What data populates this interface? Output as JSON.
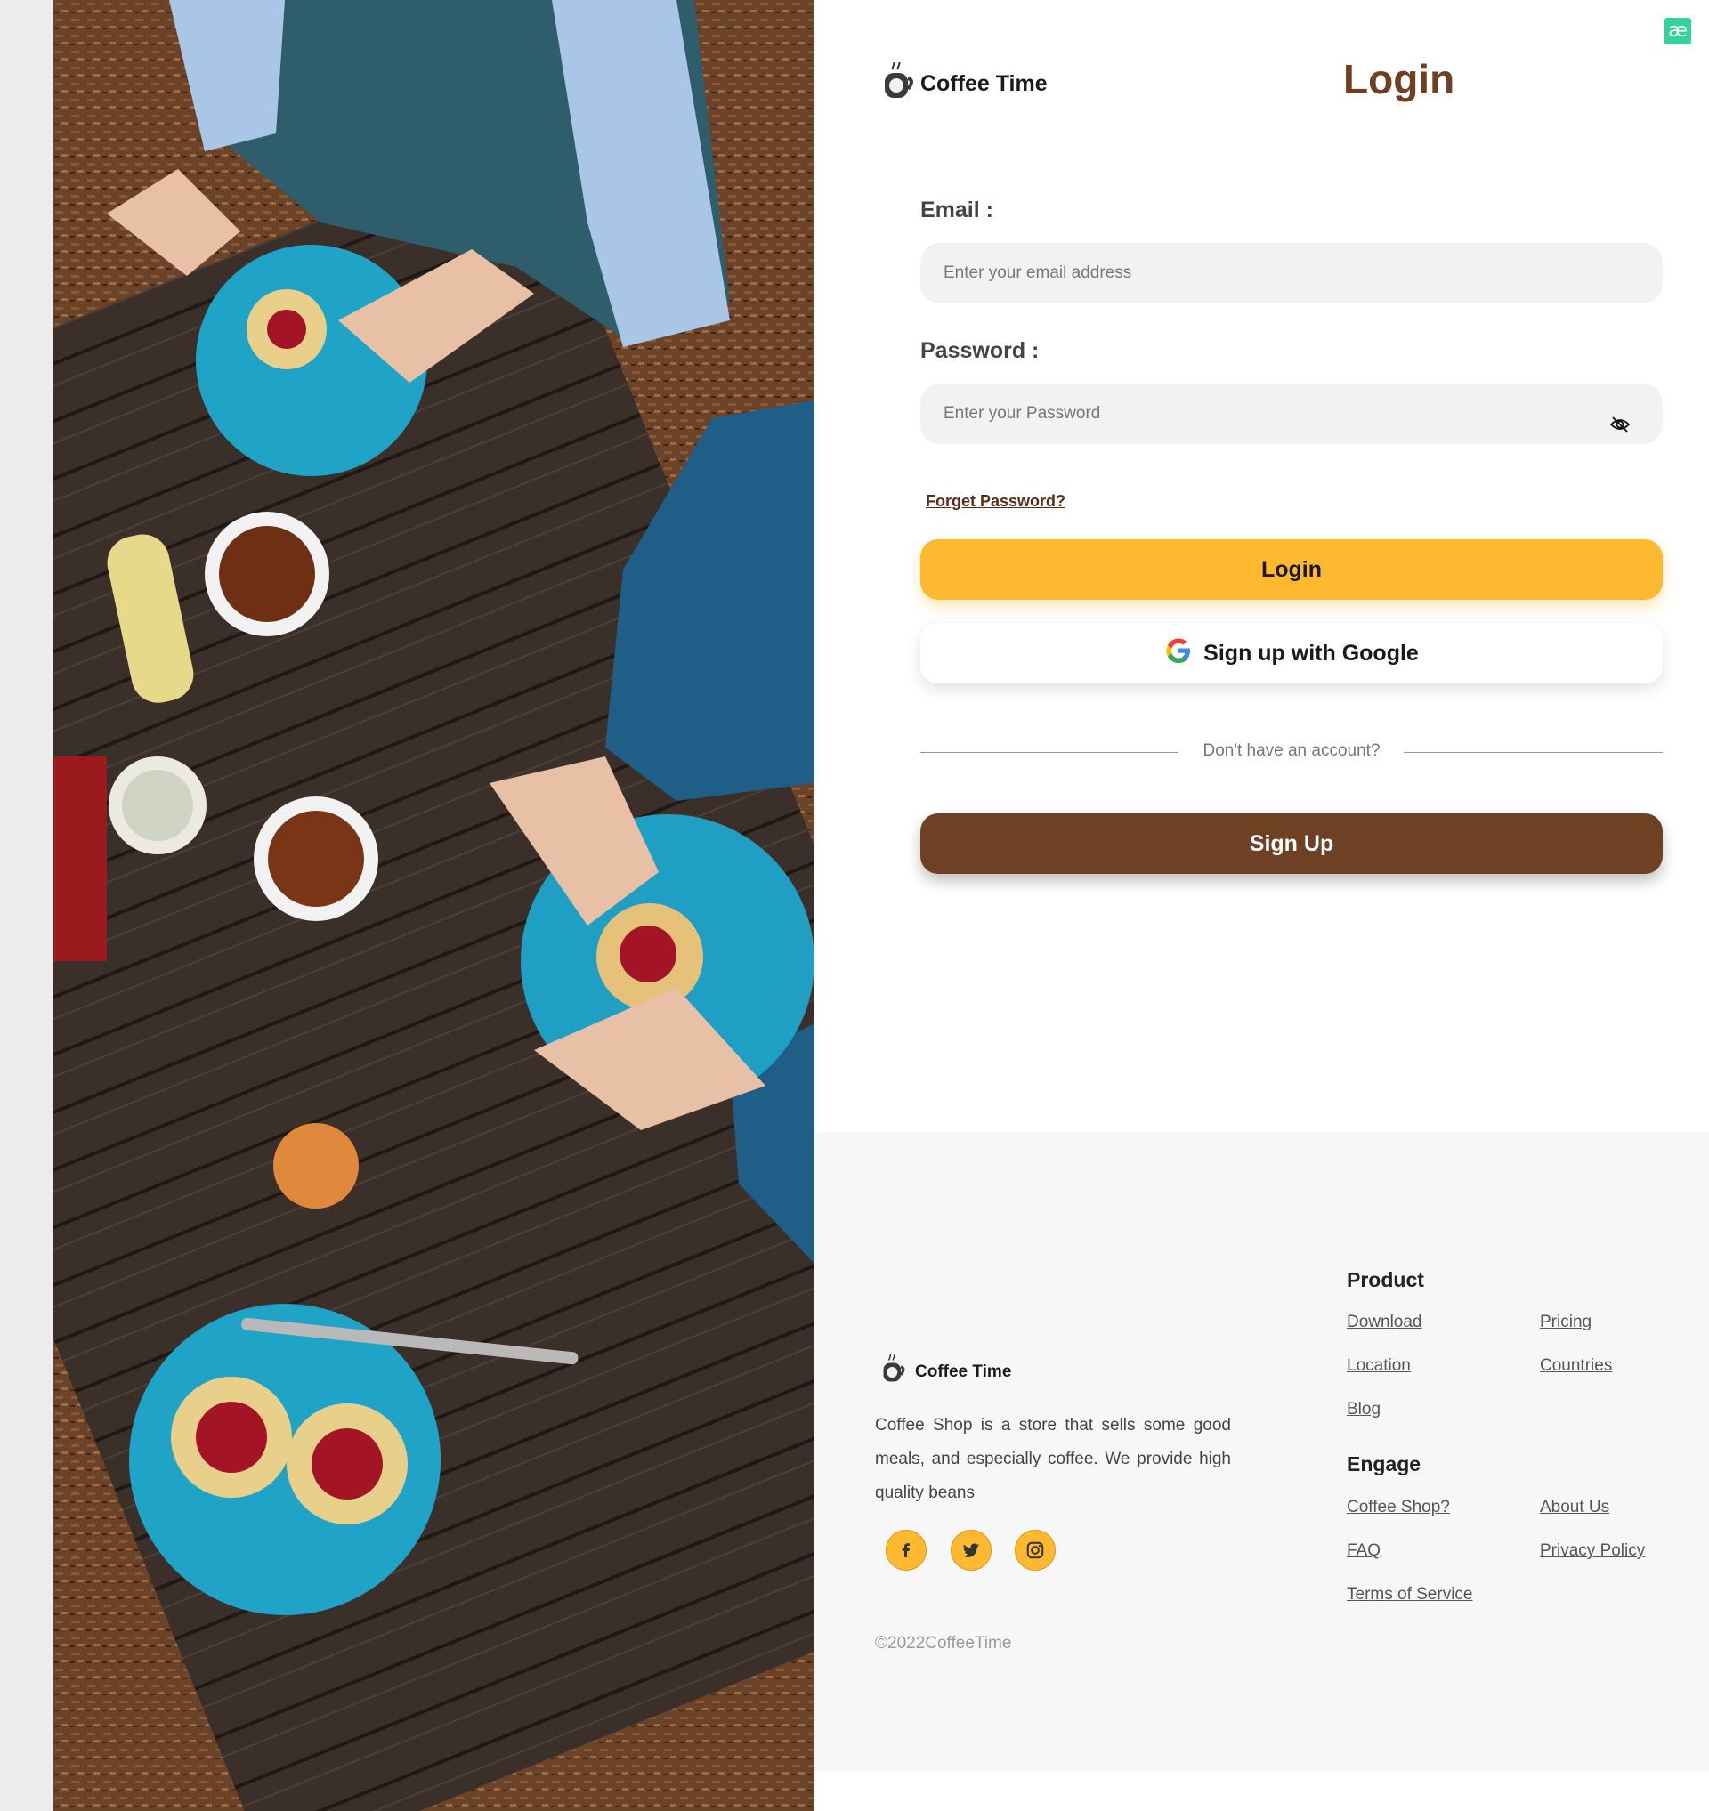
{
  "brand": {
    "name": "Coffee Time",
    "icon": "coffee-cup-logo-icon"
  },
  "page": {
    "title": "Login"
  },
  "form": {
    "email_label": "Email :",
    "email_placeholder": "Enter your email address",
    "password_label": "Password :",
    "password_placeholder": "Enter your Password",
    "forgot_label": "Forget Password?",
    "login_label": "Login",
    "google_label": "Sign up with Google",
    "divider_text": "Don't have an account?",
    "signup_label": "Sign Up"
  },
  "footer": {
    "brand_name": "Coffee Time",
    "description": "Coffee Shop is a store that sells some good meals, and especially coffee. We provide high quality beans",
    "social": [
      "facebook-icon",
      "twitter-icon",
      "instagram-icon"
    ],
    "product_heading": "Product",
    "product_links": [
      "Download",
      "Pricing",
      "Location",
      "Countries",
      "Blog"
    ],
    "engage_heading": "Engage",
    "engage_links": [
      "Coffee Shop?",
      "About Us",
      "FAQ",
      "Privacy Policy",
      "Terms of Service"
    ],
    "copyright": "©2022CoffeeTime"
  },
  "colors": {
    "accent": "#ffb930",
    "brand_brown": "#6e4024",
    "title_brown": "#6e3f22"
  }
}
